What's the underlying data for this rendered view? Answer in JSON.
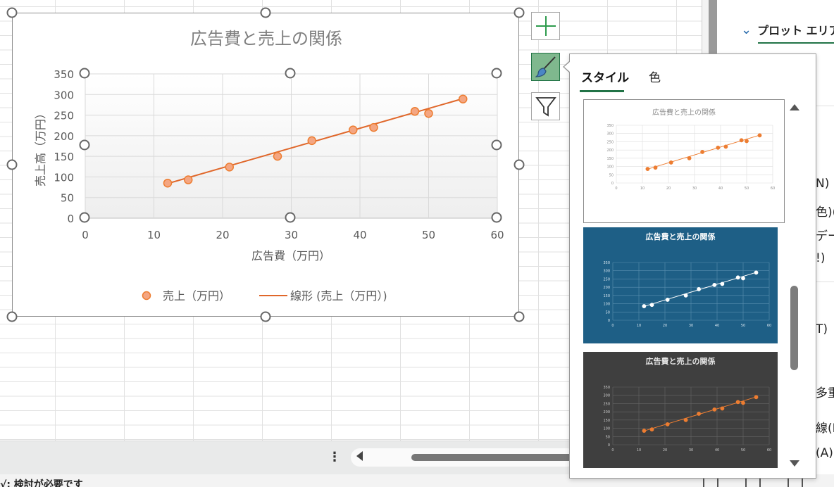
{
  "chart_data": {
    "type": "scatter",
    "title": "広告費と売上の関係",
    "xlabel": "広告費（万円）",
    "ylabel": "売上高（万円）",
    "xlim": [
      0,
      60
    ],
    "ylim": [
      0,
      350
    ],
    "x_ticks": [
      "0",
      "10",
      "20",
      "30",
      "40",
      "50",
      "60"
    ],
    "y_ticks": [
      "0",
      "50",
      "100",
      "150",
      "200",
      "250",
      "300",
      "350"
    ],
    "grid": true,
    "legend_position": "bottom",
    "series": [
      {
        "name": "売上（万円）",
        "color": "#ed7d31",
        "x": [
          12,
          15,
          21,
          28,
          33,
          39,
          42,
          48,
          50,
          55
        ],
        "y": [
          85,
          93,
          124,
          150,
          188,
          214,
          220,
          259,
          254,
          289
        ]
      }
    ],
    "trendline": {
      "name": "線形 (売上（万円）)",
      "color": "#e0672a",
      "x": [
        12,
        55
      ],
      "y": [
        84,
        290
      ]
    }
  },
  "style_flyout": {
    "tab_style": "スタイル",
    "tab_color": "色"
  },
  "format_pane": {
    "header": "プロット エリアの",
    "fragments": [
      "N)",
      "色)(",
      "デー",
      "!)",
      "T)",
      "多重",
      "線(I",
      "(A)"
    ]
  },
  "status_bar": {
    "text": "√: 検討が必要です"
  },
  "icons": {
    "add_element": "plus-icon",
    "style": "paintbrush-icon",
    "filter": "funnel-icon"
  },
  "colors": {
    "accent_green": "#217346",
    "series_orange": "#ed7d31",
    "thumb_blue_bg": "#1e5f86",
    "thumb_dark_bg": "#3f3f3f"
  }
}
